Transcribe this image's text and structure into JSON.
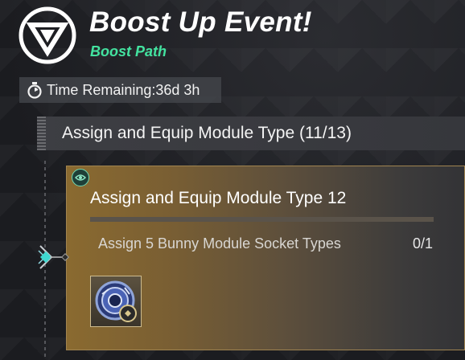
{
  "header": {
    "title": "Boost Up Event!",
    "subtitle": "Boost Path"
  },
  "timer": {
    "label": "Time Remaining:36d 3h",
    "icon": "stopwatch-icon"
  },
  "section": {
    "label": "Assign and Equip Module Type  (11/13)"
  },
  "mission": {
    "title": "Assign and Equip Module Type 12",
    "progress": 0,
    "task": "Assign 5 Bunny Module Socket Types",
    "count": "0/1",
    "reward_icon": "module-reward-icon"
  },
  "colors": {
    "accent_green": "#43e3a0",
    "card_gold": "#8a6a30",
    "node_cyan": "#3fd8d0"
  }
}
